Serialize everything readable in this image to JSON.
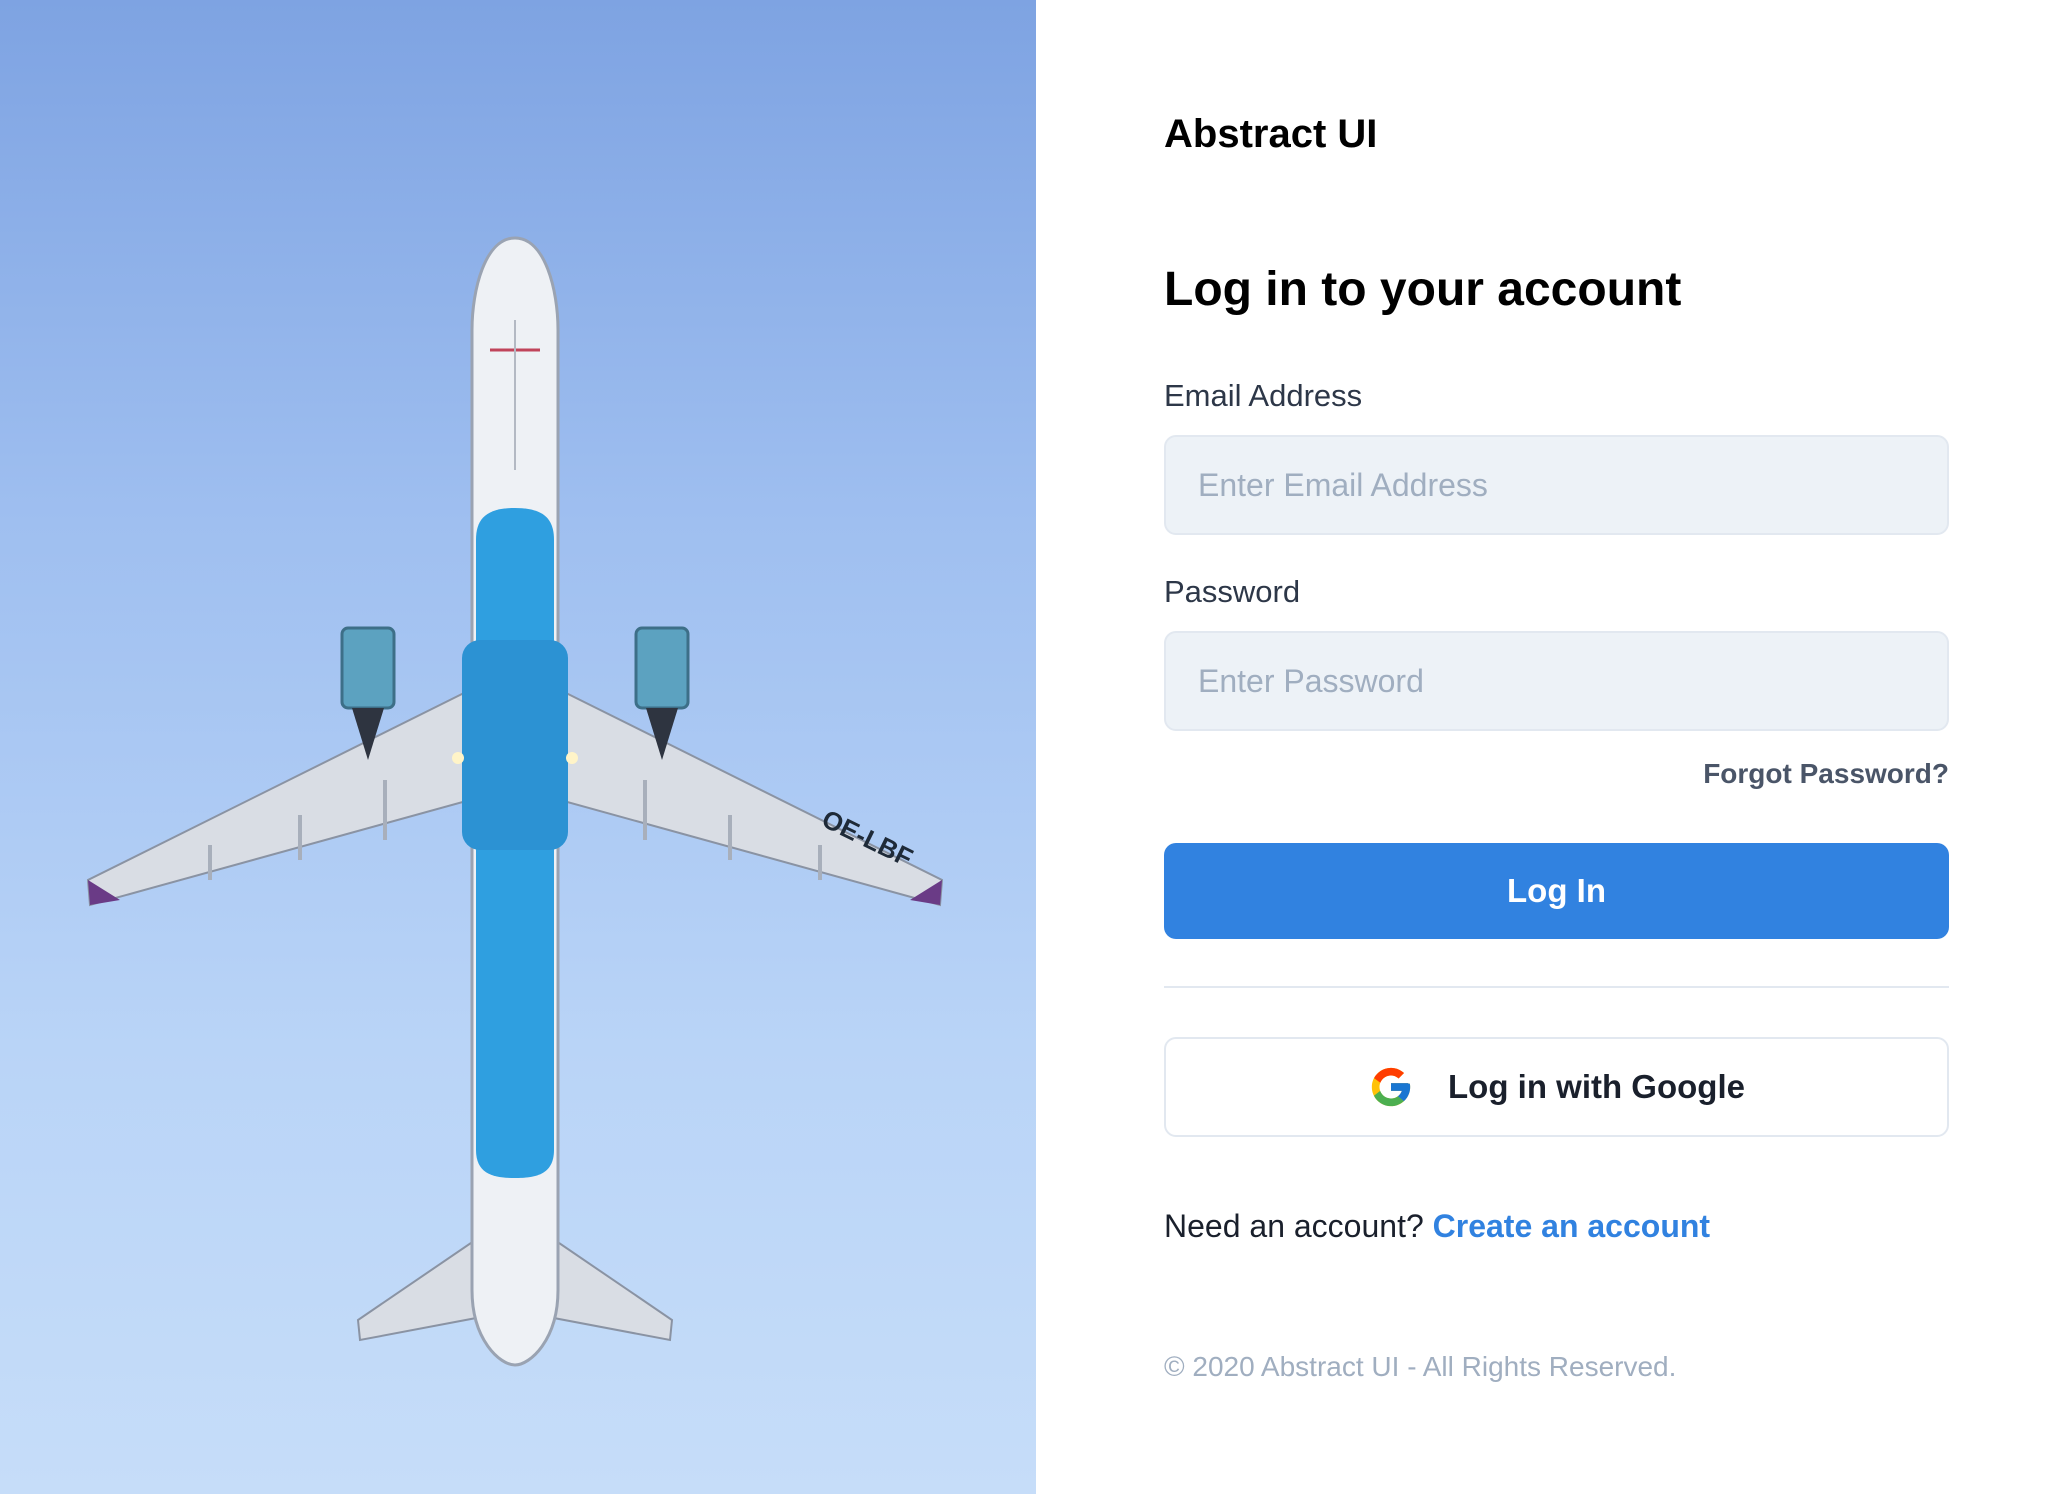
{
  "brand": {
    "name": "Abstract UI"
  },
  "form": {
    "heading": "Log in to your account",
    "email": {
      "label": "Email Address",
      "placeholder": "Enter Email Address",
      "value": ""
    },
    "password": {
      "label": "Password",
      "placeholder": "Enter Password",
      "value": ""
    },
    "forgot_password": "Forgot Password?",
    "login_button": "Log In",
    "google_button": "Log in with Google",
    "google_icon": "google-logo-icon"
  },
  "signup": {
    "prompt": "Need an account?",
    "link": "Create an account"
  },
  "footer": {
    "copyright": "© 2020 Abstract UI - All Rights Reserved."
  },
  "hero": {
    "description_icon": "airplane-photo",
    "registration": "OE-LBF"
  },
  "colors": {
    "accent": "#3182e0",
    "input_bg": "#edf2f7",
    "text_dark": "#1a202c",
    "text_muted": "#a0aec0",
    "sky": "#a8c6f3"
  }
}
